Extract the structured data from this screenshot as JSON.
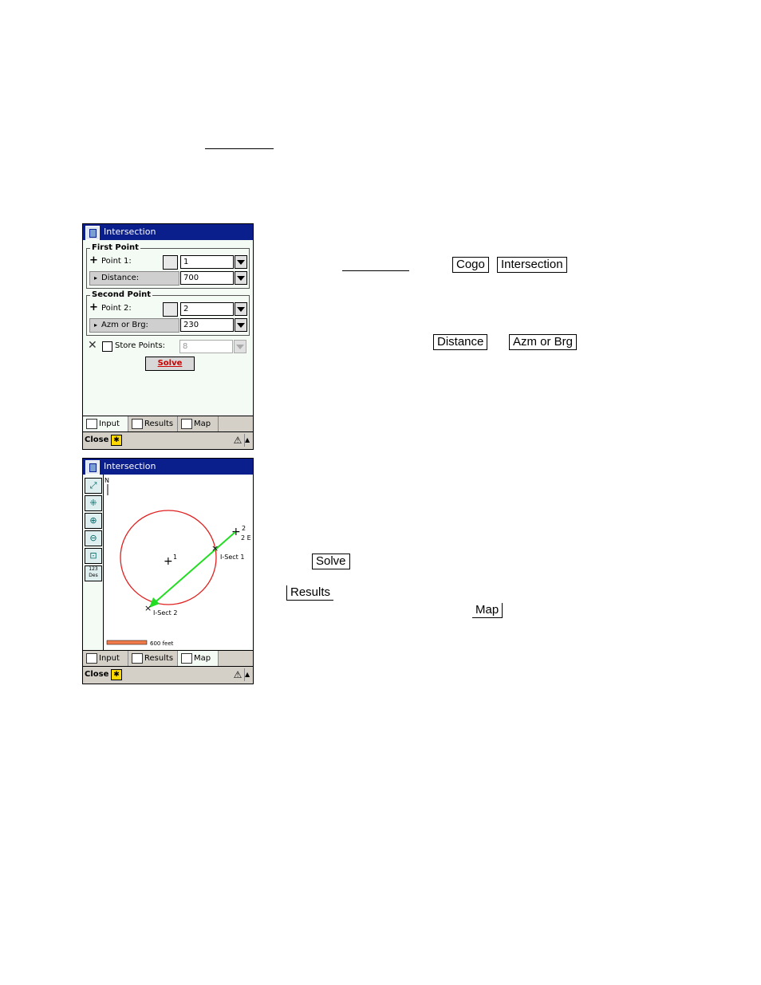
{
  "document": {
    "step1": {
      "btn_cogo": "Cogo",
      "btn_intersection": "Intersection"
    },
    "step2": {
      "btn_distance": "Distance",
      "btn_azm": "Azm or Brg"
    },
    "step3": {
      "btn_solve": "Solve",
      "btn_results": "Results",
      "btn_map": "Map"
    }
  },
  "screen_input": {
    "title": "Intersection",
    "first_point": {
      "group_title": "First Point",
      "point_label": "Point 1:",
      "point_value": "1",
      "mode_label": "Distance:",
      "mode_value": "700"
    },
    "second_point": {
      "group_title": "Second Point",
      "point_label": "Point 2:",
      "point_value": "2",
      "mode_label": "Azm or Brg:",
      "mode_value": "230"
    },
    "store_label": "Store Points:",
    "store_value": "8",
    "solve_label": "Solve"
  },
  "screen_map": {
    "title": "Intersection",
    "north_label": "N",
    "point1_label": "1",
    "point2_label": "2",
    "point2_extra": "2 E",
    "sect1_label": "I-Sect 1",
    "sect2_label": "I-Sect 2",
    "scale_label": "600 feet",
    "units_tool_top": "123",
    "units_tool_bottom": "Des",
    "circle_color": "#e02020",
    "line_color": "#22dd22"
  },
  "tabs": {
    "input": "Input",
    "results": "Results",
    "map": "Map"
  },
  "cmdbar": {
    "close": "Close"
  }
}
